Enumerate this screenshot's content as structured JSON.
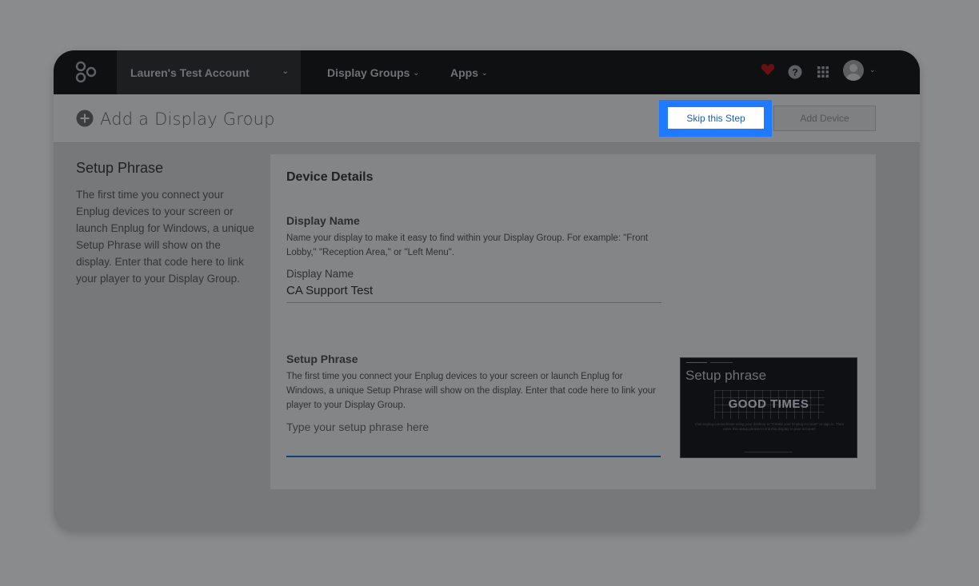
{
  "topbar": {
    "account_name": "Lauren's Test Account",
    "nav": [
      {
        "label": "Display Groups"
      },
      {
        "label": "Apps"
      }
    ]
  },
  "header": {
    "title": "Add a Display Group",
    "skip_label": "Skip this Step",
    "add_device_label": "Add Device"
  },
  "sidebar": {
    "title": "Setup Phrase",
    "text": "The first time you connect your Enplug devices to your screen or launch Enplug for Windows, a unique Setup Phrase will show on the display. Enter that code here to link your player to your Display Group."
  },
  "card": {
    "title": "Device Details",
    "display_name": {
      "label": "Display Name",
      "description": "Name your display to make it easy to find within your Display Group. For example: \"Front Lobby,\" \"Reception Area,\" or \"Left Menu\".",
      "caption": "Display Name",
      "value": "CA Support Test"
    },
    "setup_phrase": {
      "label": "Setup Phrase",
      "description": "The first time you connect your Enplug devices to your screen or launch Enplug for Windows, a unique Setup Phrase will show on the display. Enter that code here to link your player to your Display Group.",
      "placeholder": "Type your setup phrase here"
    },
    "preview": {
      "title": "Setup phrase",
      "phrase": "GOOD TIMES",
      "fine_print": "Visit enplug.com/activate using your desktop to \"Create your Enplug Account\" or sign in. Then enter this setup phrase to link this display to your account!"
    }
  },
  "colors": {
    "highlight": "#1e7bff",
    "heart": "#c0141c",
    "topbar": "#0f1011"
  }
}
